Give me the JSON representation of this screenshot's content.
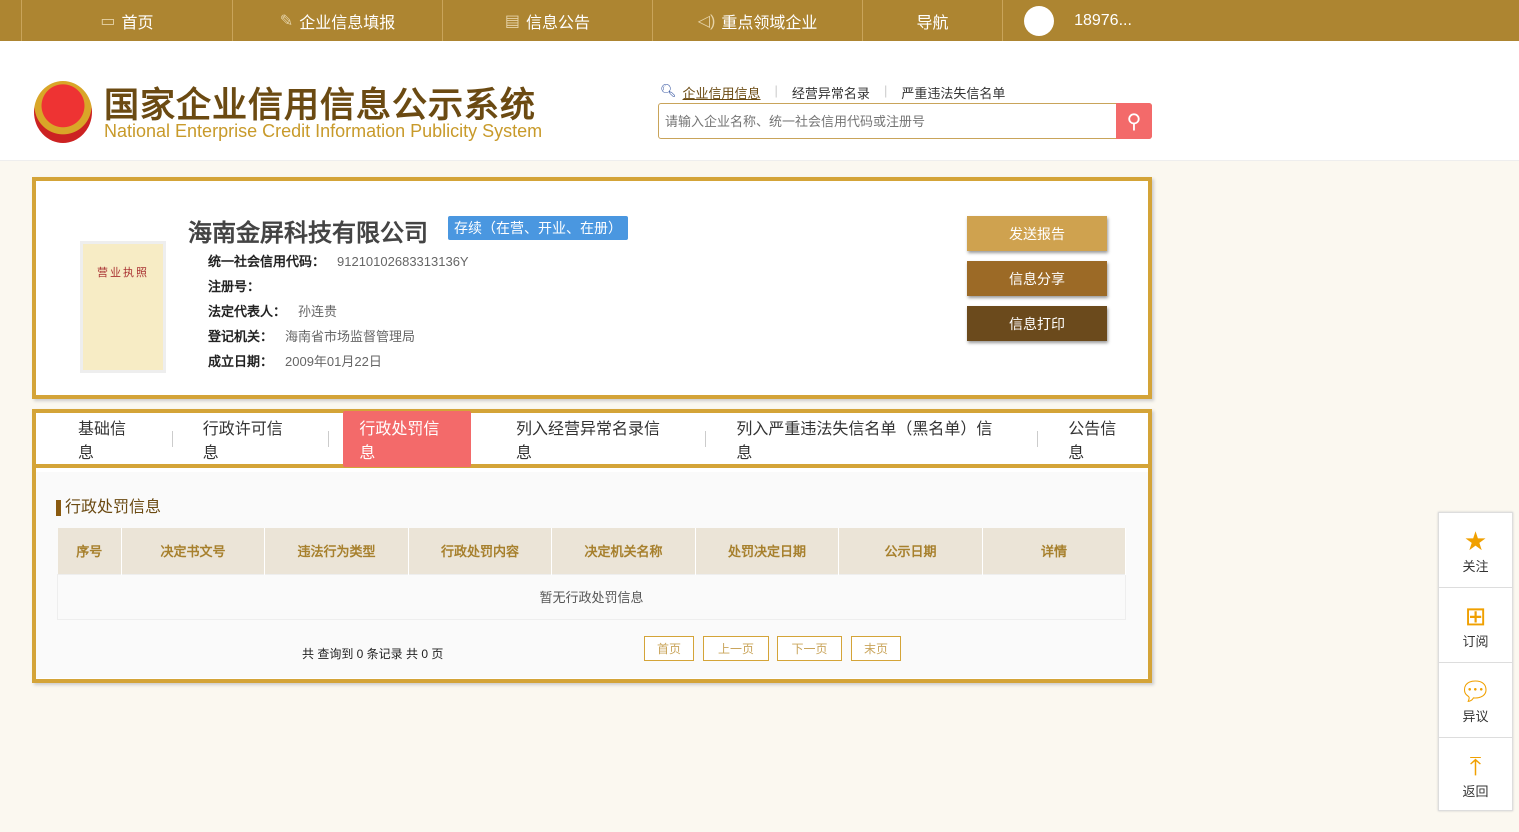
{
  "nav": {
    "items": [
      {
        "label": "首页",
        "icon": "monitor-icon"
      },
      {
        "label": "企业信息填报",
        "icon": "pen-icon"
      },
      {
        "label": "信息公告",
        "icon": "document-icon"
      },
      {
        "label": "重点领域企业",
        "icon": "speaker-icon"
      },
      {
        "label": "导航"
      }
    ],
    "user": "18976..."
  },
  "header": {
    "title_cn": "国家企业信用信息公示系统",
    "title_en": "National Enterprise Credit Information Publicity System",
    "links": [
      "企业信用信息",
      "经营异常名录",
      "严重违法失信名单"
    ],
    "search_placeholder": "请输入企业名称、统一社会信用代码或注册号"
  },
  "company": {
    "license_label": "营业执照",
    "name": "海南金屏科技有限公司",
    "status": "存续（在营、开业、在册）",
    "fields": [
      {
        "label": "统一社会信用代码：",
        "value": "91210102683313136Y"
      },
      {
        "label": "注册号：",
        "value": ""
      },
      {
        "label": "法定代表人：",
        "value": "孙连贵"
      },
      {
        "label": "登记机关：",
        "value": "海南省市场监督管理局"
      },
      {
        "label": "成立日期：",
        "value": "2009年01月22日"
      }
    ],
    "buttons": [
      "发送报告",
      "信息分享",
      "信息打印"
    ]
  },
  "tabs": [
    "基础信息",
    "行政许可信息",
    "行政处罚信息",
    "列入经营异常名录信息",
    "列入严重违法失信名单（黑名单）信息",
    "公告信息"
  ],
  "section": {
    "title": "行政处罚信息",
    "columns": [
      "序号",
      "决定书文号",
      "违法行为类型",
      "行政处罚内容",
      "决定机关名称",
      "处罚决定日期",
      "公示日期",
      "详情"
    ],
    "empty": "暂无行政处罚信息",
    "pager_info": "共 查询到 0 条记录 共 0 页",
    "pager": [
      "首页",
      "上一页",
      "下一页",
      "末页"
    ]
  },
  "float": [
    "关注",
    "订阅",
    "异议",
    "返回"
  ],
  "colors": {
    "gold": "#ad8531",
    "border": "#d4a438",
    "active": "#f36a6a",
    "status": "#4a97e0"
  }
}
